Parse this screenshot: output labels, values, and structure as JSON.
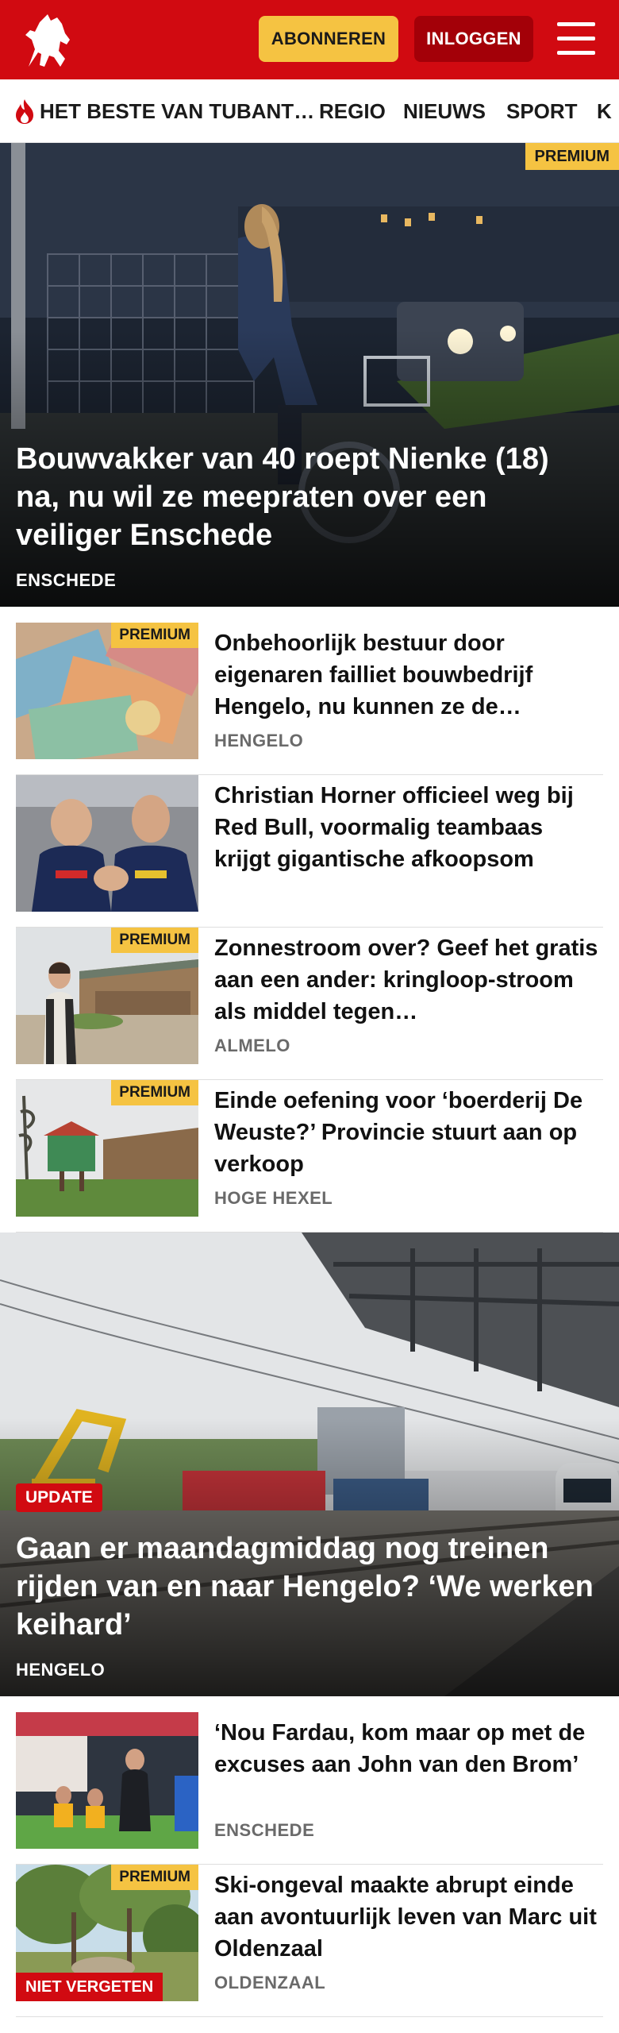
{
  "header": {
    "logo": "tubantia-horse-logo",
    "subscribe_label": "ABONNEREN",
    "login_label": "INLOGGEN",
    "menu_icon": "hamburger-menu-icon"
  },
  "nav": {
    "items": [
      {
        "label": "HET BESTE VAN TUBANT…",
        "icon": "flame-icon"
      },
      {
        "label": "REGIO"
      },
      {
        "label": "NIEUWS"
      },
      {
        "label": "SPORT"
      },
      {
        "label": "K"
      }
    ]
  },
  "hero1": {
    "badge": "PREMIUM",
    "title": "Bouwvakker van 40 roept Nienke (18) na, nu wil ze meepraten over een veiliger Enschede",
    "location": "ENSCHEDE"
  },
  "list1": [
    {
      "badge": "PREMIUM",
      "title": "Onbehoorlijk bestuur door eigenaren failliet bouwbedrijf Hengelo, nu kunnen ze de…",
      "location": "HENGELO"
    },
    {
      "badge": "",
      "title": "Christian Horner officieel weg bij Red Bull, voormalig teambaas krijgt gigantische afkoopsom",
      "location": ""
    },
    {
      "badge": "PREMIUM",
      "title": "Zonnestroom over? Geef het gratis aan een ander: kringloop-stroom als middel tegen…",
      "location": "ALMELO"
    },
    {
      "badge": "PREMIUM",
      "title": "Einde oefening voor ‘boerderij De Weuste?’ Provincie stuurt aan op verkoop",
      "location": "HOGE HEXEL"
    }
  ],
  "hero2": {
    "badge": "UPDATE",
    "title": "Gaan er maandagmiddag nog treinen rijden van en naar Hengelo? ‘We werken keihard’",
    "location": "HENGELO"
  },
  "list2": [
    {
      "badge": "",
      "title": "‘Nou Fardau, kom maar op met de excuses aan John van den Brom’",
      "location": "ENSCHEDE",
      "extra": ""
    },
    {
      "badge": "PREMIUM",
      "title": "Ski-ongeval maakte abrupt einde aan avontuurlijk leven van Marc uit Oldenzaal",
      "location": "OLDENZAAL",
      "extra": "NIET VERGETEN"
    }
  ],
  "colors": {
    "brand_red": "#d10a11",
    "premium_yellow": "#f5c342",
    "login_dark_red": "#a30008"
  }
}
